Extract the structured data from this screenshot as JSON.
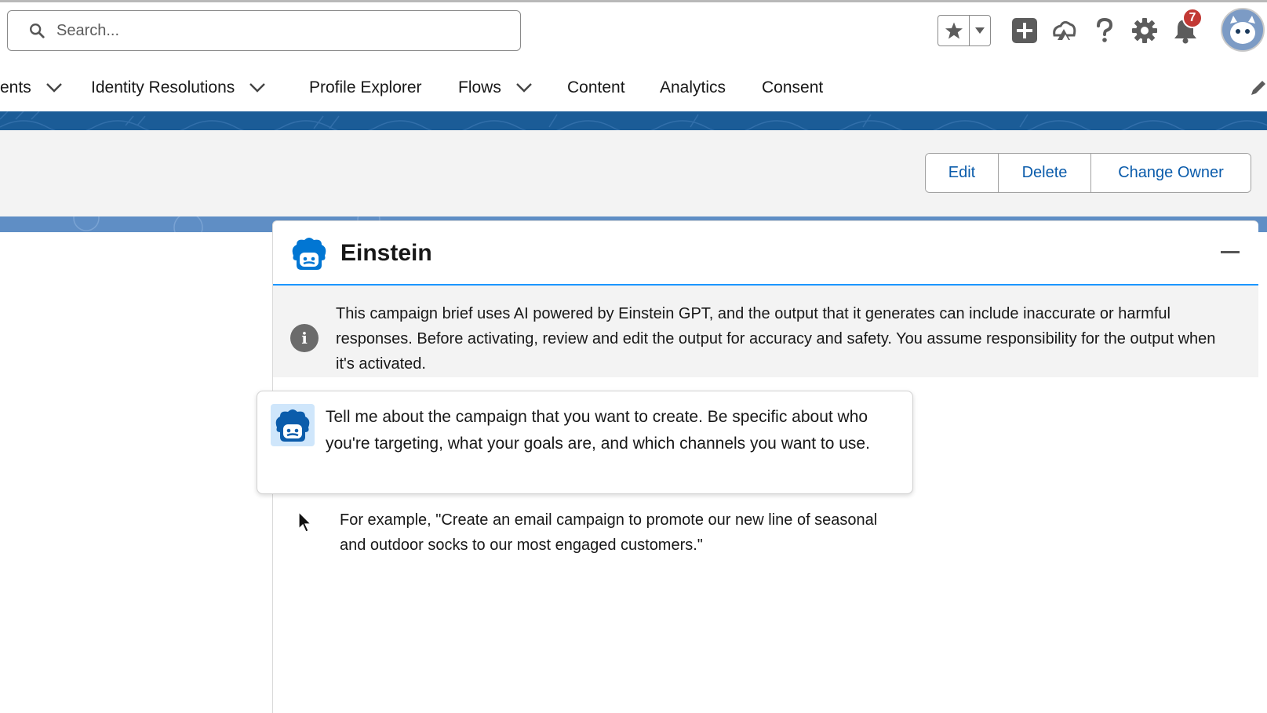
{
  "header": {
    "search_placeholder": "Search...",
    "notification_count": "7"
  },
  "nav": {
    "items": [
      {
        "label": "ents",
        "has_menu": true
      },
      {
        "label": "Identity Resolutions",
        "has_menu": true
      },
      {
        "label": "Profile Explorer",
        "has_menu": false
      },
      {
        "label": "Flows",
        "has_menu": true
      },
      {
        "label": "Content",
        "has_menu": false
      },
      {
        "label": "Analytics",
        "has_menu": false
      },
      {
        "label": "Consent",
        "has_menu": false
      }
    ]
  },
  "actions": {
    "edit": "Edit",
    "delete": "Delete",
    "change_owner": "Change Owner"
  },
  "einstein": {
    "title": "Einstein",
    "notice": "This campaign brief uses AI powered by Einstein GPT, and the output that it generates can include inaccurate or harmful responses. Before activating, review and edit the output for accuracy and safety. You assume responsibility for the output when it's activated.",
    "prompt": "Tell me about the campaign that you want to create. Be specific about who you're targeting, what your goals are, and which channels you want to use.",
    "example": "For example, \"Create an email campaign to promote our new line of seasonal and outdoor socks to our most engaged customers.\""
  },
  "colors": {
    "brand_blue": "#1b5c97",
    "link_blue": "#0b5cab",
    "accent_blue": "#1b96ff",
    "badge_red": "#c23934"
  },
  "icons": [
    "search-icon",
    "star-icon",
    "chevron-down-icon",
    "add-icon",
    "trailhead-icon",
    "help-icon",
    "gear-icon",
    "bell-icon",
    "avatar",
    "pencil-icon",
    "einstein-icon",
    "minimize-icon",
    "info-icon",
    "cursor-icon"
  ]
}
